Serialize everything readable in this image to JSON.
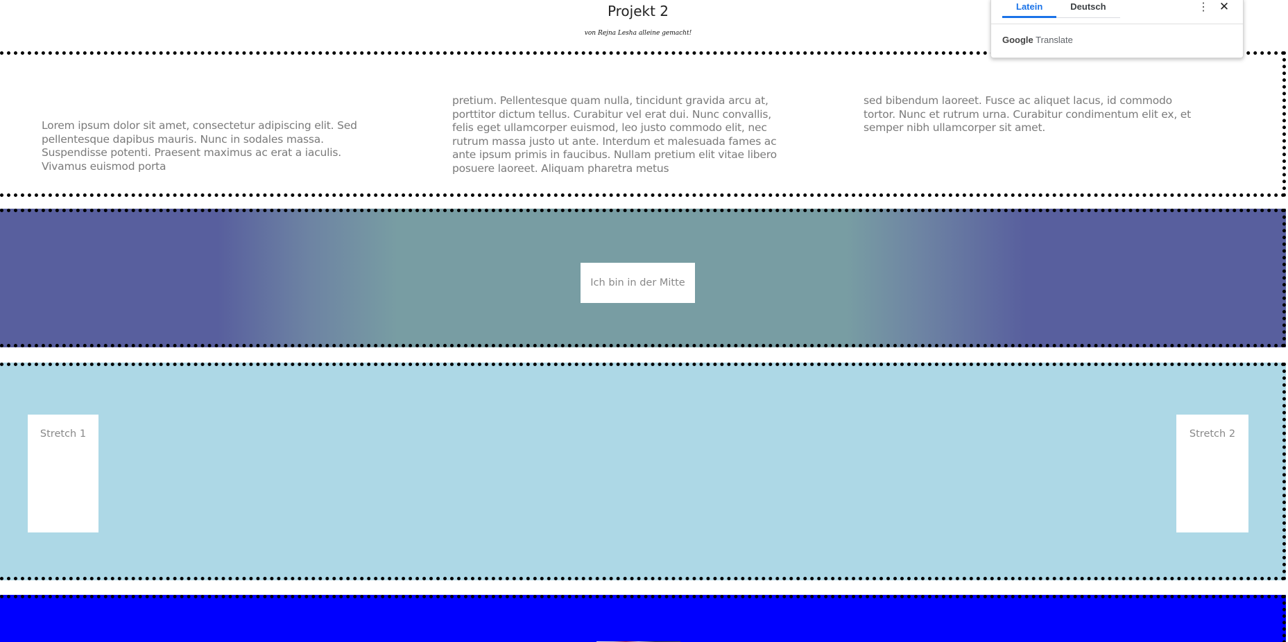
{
  "header": {
    "title": "Projekt 2",
    "subtitle": "von Rejna Lesha alleine gemacht!"
  },
  "text_section": {
    "columns": [
      "Lorem ipsum dolor sit amet, consectetur adipiscing elit. Sed pellentesque dapibus mauris. Nunc in sodales massa. Suspendisse potenti. Praesent maximus ac erat a iaculis. Vivamus euismod porta",
      "pretium. Pellentesque quam nulla, tincidunt gravida arcu at, porttitor dictum tellus. Curabitur vel erat dui. Nunc convallis, felis eget ullamcorper euismod, leo justo commodo elit, nec rutrum massa justo ut ante. Interdum et malesuada fames ac ante ipsum primis in faucibus. Nullam pretium elit vitae libero posuere laoreet. Aliquam pharetra metus",
      "sed bibendum laoreet. Fusce ac aliquet lacus, id commodo tortor. Nunc et rutrum urna. Curabitur condimentum elit ex, et semper nibh ullamcorper sit amet."
    ]
  },
  "gradient_section": {
    "center_label": "Ich bin in der Mitte",
    "colors": {
      "edge": "#585f9e",
      "center": "#789da3"
    }
  },
  "stretch_section": {
    "background": "#add8e6",
    "box_1_label": "Stretch 1",
    "box_2_label": "Stretch 2"
  },
  "blue_section": {
    "background": "#0000ff"
  },
  "translate_popup": {
    "tabs": [
      {
        "label": "Latein",
        "active": true
      },
      {
        "label": "Deutsch",
        "active": false
      }
    ],
    "menu_icon": "more-vertical-icon",
    "close_icon": "close-icon",
    "brand_google": "Google",
    "brand_translate": "Translate",
    "accent_color": "#1a73e8"
  }
}
